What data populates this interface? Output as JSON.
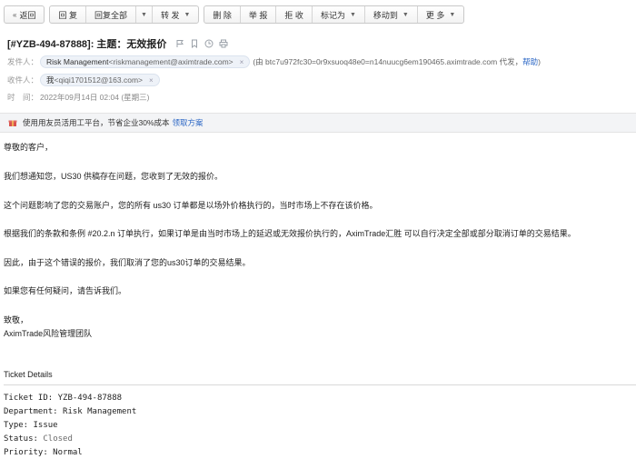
{
  "toolbar": {
    "back": "返回",
    "reply": "回 复",
    "reply_all": "回复全部",
    "forward": "转 发",
    "delete": "删 除",
    "report": "举 报",
    "reject": "拒 收",
    "mark_as": "标记为",
    "move_to": "移动到",
    "more": "更 多"
  },
  "header": {
    "subject": "[#YZB-494-87888]: 主题：无效报价",
    "from_label": "发件人：",
    "from_name": "Risk Management",
    "from_addr": "<riskmanagement@aximtrade.com>",
    "via_text": "(由 btc7u972fc30=0r9xsuoq48e0=n14nuucg6em190465.aximtrade.com 代发，",
    "help": "帮助",
    "via_close": ")",
    "to_label": "收件人：",
    "to_name": "我",
    "to_addr": "<qiqi1701512@163.com>",
    "time_label": "时　间：",
    "time_value": "2022年09月14日 02:04 (星期三)"
  },
  "notice": {
    "text": "使用用友员活用工平台，节省企业30%成本",
    "link": "领取方案"
  },
  "body": {
    "p1": "尊敬的客户，",
    "p2": "我们想通知您，US30 供稿存在问题，您收到了无效的报价。",
    "p3": "这个问题影响了您的交易账户，您的所有 us30 订单都是以场外价格执行的，当时市场上不存在该价格。",
    "p4": "根据我们的条款和条例 #20.2.n 订单执行，如果订单是由当时市场上的延迟或无效报价执行的，AximTrade汇胜 可以自行决定全部或部分取消订单的交易结果。",
    "p5": "因此，由于这个错误的报价，我们取消了您的us30订单的交易结果。",
    "p6": "如果您有任何疑问，请告诉我们。",
    "p7": "致敬，",
    "p8": "AximTrade风险管理团队"
  },
  "ticket": {
    "title": "Ticket Details",
    "id_line": "Ticket ID: YZB-494-87888",
    "dept_line": "Department: Risk Management",
    "type_line": "Type: Issue",
    "status_label": "Status: ",
    "status_value": "Closed",
    "priority_line": "Priority: Normal"
  },
  "colors": {
    "link": "#2c67c5",
    "chip_bg": "#eef2f8",
    "notice_bg": "#f3f4f6"
  }
}
